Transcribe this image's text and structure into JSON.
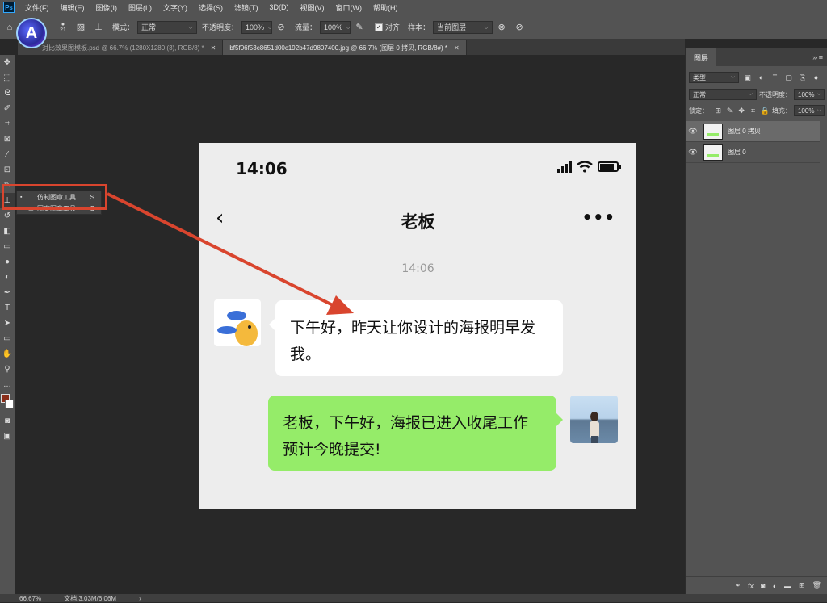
{
  "menu": [
    "文件(F)",
    "编辑(E)",
    "图像(I)",
    "图层(L)",
    "文字(Y)",
    "选择(S)",
    "滤镜(T)",
    "3D(D)",
    "视图(V)",
    "窗口(W)",
    "帮助(H)"
  ],
  "options": {
    "brush_size": "21",
    "mode_label": "模式：",
    "mode_value": "正常",
    "opacity_label": "不透明度：",
    "opacity_value": "100%",
    "flow_label": "流量：",
    "flow_value": "100%",
    "aligned_label": "对齐",
    "sample_label": "样本：",
    "sample_value": "当前图层"
  },
  "tabs": [
    {
      "label": "对比效果图模板.psd @ 66.7% (1280X1280 (3), RGB/8) *"
    },
    {
      "label": "bf5f06f53c8651d00c192b47d9807400.jpg @ 66.7% (图层 0 拷贝, RGB/8#) *"
    }
  ],
  "flyout": {
    "item1": "仿制图章工具",
    "item1_key": "S",
    "item2": "图案图章工具",
    "item2_key": "S"
  },
  "phone": {
    "time": "14:06",
    "title": "老板",
    "timestamp": "14:06",
    "msg_left": "下午好，昨天让你设计的海报明早发我。",
    "msg_right": "老板，下午好，海报已进入收尾工作预计今晚提交!"
  },
  "layers_panel": {
    "tab": "图层",
    "filter_kind": "类型",
    "blend_mode": "正常",
    "opacity_label": "不透明度：",
    "opacity_value": "100%",
    "lock_label": "锁定：",
    "fill_label": "填充：",
    "fill_value": "100%",
    "layers": [
      {
        "name": "图层 0 拷贝",
        "selected": true
      },
      {
        "name": "图层 0",
        "selected": false
      }
    ]
  },
  "status": {
    "zoom": "66.67%",
    "doc": "文档:3.03M/6.06M"
  },
  "colors": {
    "annotation_red": "#d9452e",
    "bubble_green": "#95ec69",
    "foreground": "#8b2e1a",
    "background": "#ffffff"
  }
}
